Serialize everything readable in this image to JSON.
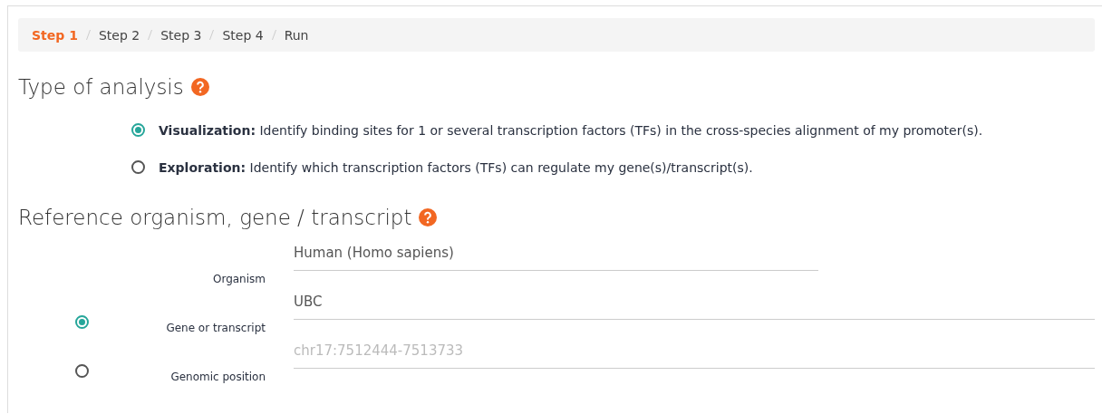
{
  "breadcrumb": [
    {
      "label": "Step 1",
      "selected": true
    },
    {
      "label": "Step 2",
      "selected": false
    },
    {
      "label": "Step 3",
      "selected": false
    },
    {
      "label": "Step 4",
      "selected": false
    },
    {
      "label": "Run",
      "selected": false
    }
  ],
  "analysis": {
    "heading": "Type of analysis",
    "options": [
      {
        "title": "Visualization:",
        "description": "Identify binding sites for 1 or several transcription factors (TFs) in the cross-species alignment of my promoter(s).",
        "selected": true
      },
      {
        "title": "Exploration:",
        "description": "Identify which transcription factors (TFs) can regulate my gene(s)/transcript(s).",
        "selected": false
      }
    ]
  },
  "reference": {
    "heading": "Reference organism, gene / transcript",
    "rows": [
      {
        "kind": "plain",
        "label": "Organism",
        "value": "Human (Homo sapiens)"
      },
      {
        "kind": "radio",
        "label": "Gene or transcript",
        "value": "UBC",
        "selected": true
      },
      {
        "kind": "radio",
        "label": "Genomic position",
        "placeholder": "chr17:7512444-7513733",
        "selected": false
      }
    ]
  }
}
